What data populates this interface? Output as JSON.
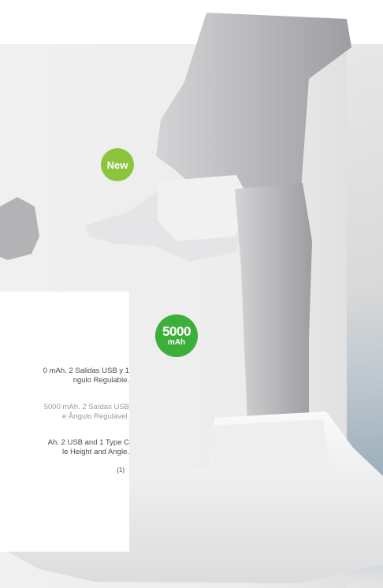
{
  "badges": {
    "new_label": "New",
    "capacity_value": "5000",
    "capacity_unit": "mAh"
  },
  "descriptions": {
    "es": [
      "0 mAh. 2 Salidas USB y 1",
      "ngulo Regulable."
    ],
    "pt": [
      "5000 mAh. 2 Saídas USB",
      "e Ângulo Regulável."
    ],
    "en": [
      "Ah. 2 USB and 1 Type C",
      "le Height and Angle."
    ]
  },
  "footnote": "(1)",
  "colors": {
    "new_badge": "#8cc43e",
    "capacity_badge": "#3cae3a",
    "background": "#ededed"
  }
}
